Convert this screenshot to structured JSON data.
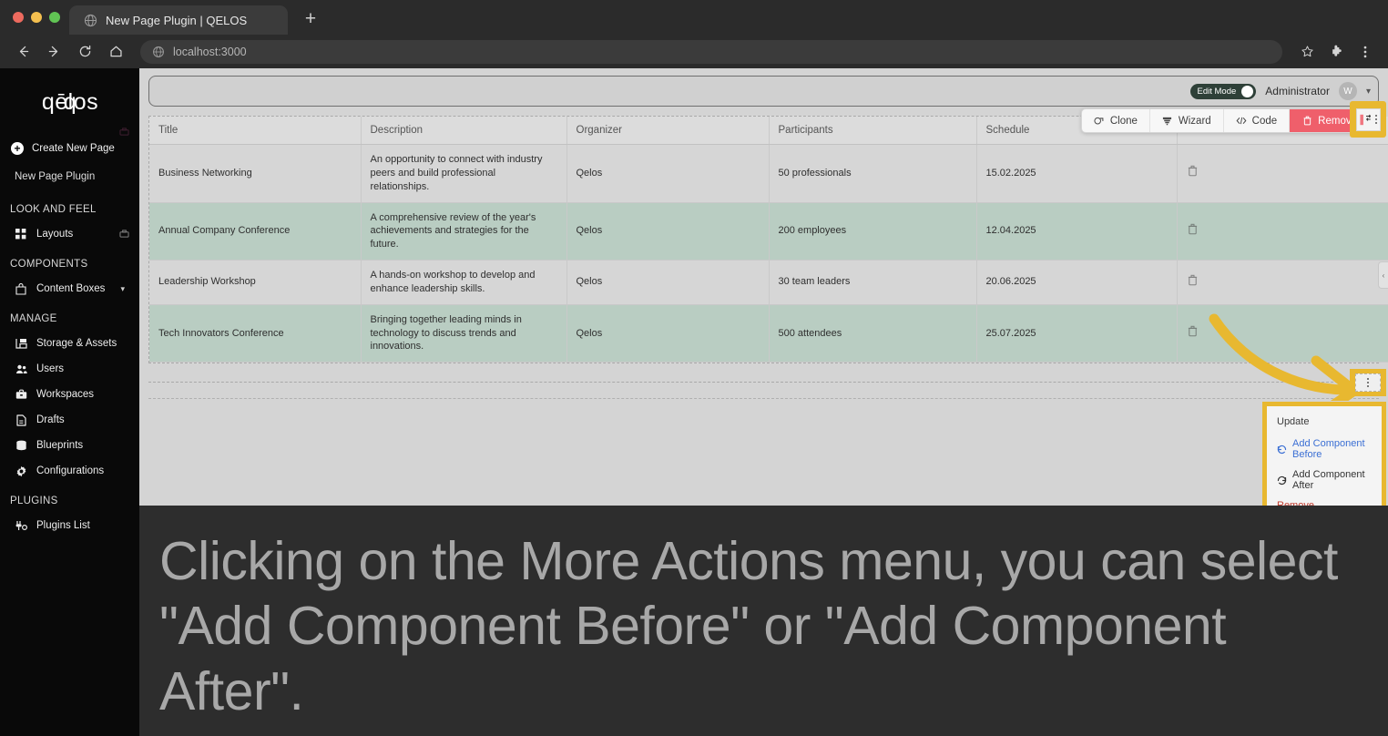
{
  "browser": {
    "tab_title": "New Page Plugin | QELOS",
    "tab_favicon_icon": "globe-icon",
    "new_tab_label": "+",
    "back_icon": "back-arrow-icon",
    "forward_icon": "forward-arrow-icon",
    "reload_icon": "reload-icon",
    "home_icon": "home-icon",
    "url": "localhost:3000",
    "url_favicon_icon": "globe-icon",
    "bookmark_icon": "star-icon",
    "extensions_icon": "puzzle-piece-icon",
    "menu_icon": "vertical-dots-icon"
  },
  "sidebar": {
    "logo": "qēlos",
    "create_new_page": "Create New Page",
    "new_page_plugin": "New Page Plugin",
    "sections": [
      {
        "title": "LOOK AND FEEL",
        "items": [
          {
            "label": "Layouts",
            "icon": "grid-icon",
            "has_tag": true
          }
        ]
      },
      {
        "title": "COMPONENTS",
        "items": [
          {
            "label": "Content Boxes",
            "icon": "box-icon",
            "has_chevron": true
          }
        ]
      },
      {
        "title": "MANAGE",
        "items": [
          {
            "label": "Storage & Assets",
            "icon": "storage-icon"
          },
          {
            "label": "Users",
            "icon": "users-icon"
          },
          {
            "label": "Workspaces",
            "icon": "briefcase-icon"
          },
          {
            "label": "Drafts",
            "icon": "document-icon"
          },
          {
            "label": "Blueprints",
            "icon": "database-icon"
          },
          {
            "label": "Configurations",
            "icon": "gear-icon"
          }
        ]
      },
      {
        "title": "PLUGINS",
        "items": [
          {
            "label": "Plugins List",
            "icon": "plug-icon"
          }
        ]
      }
    ]
  },
  "topbar": {
    "edit_mode_label": "Edit Mode",
    "edit_mode_on": true,
    "user_name": "Administrator",
    "avatar_initial": "W",
    "caret_icon": "chevron-down-icon"
  },
  "toolbar": {
    "buttons": [
      {
        "label": "Clone",
        "icon": "clone-icon"
      },
      {
        "label": "Wizard",
        "icon": "wizard-icon"
      },
      {
        "label": "Code",
        "icon": "code-icon"
      },
      {
        "label": "Remove",
        "icon": "trash-icon",
        "danger": true
      }
    ],
    "more_actions_icon": "more-actions-icon"
  },
  "table": {
    "columns": [
      "Title",
      "Description",
      "Organizer",
      "Participants",
      "Schedule",
      ""
    ],
    "row_action_icon": "trash-icon",
    "rows": [
      {
        "title": "Business Networking",
        "description": "An opportunity to connect with industry peers and build professional relationships.",
        "organizer": "Qelos",
        "participants": "50 professionals",
        "schedule": "15.02.2025"
      },
      {
        "title": "Annual Company Conference",
        "description": "A comprehensive review of the year's achievements and strategies for the future.",
        "organizer": "Qelos",
        "participants": "200 employees",
        "schedule": "12.04.2025"
      },
      {
        "title": "Leadership Workshop",
        "description": "A hands-on workshop to develop and enhance leadership skills.",
        "organizer": "Qelos",
        "participants": "30 team leaders",
        "schedule": "20.06.2025"
      },
      {
        "title": "Tech Innovators Conference",
        "description": "Bringing together leading minds in technology to discuss trends and innovations.",
        "organizer": "Qelos",
        "participants": "500 attendees",
        "schedule": "25.07.2025"
      }
    ]
  },
  "dropdown": {
    "header": "Update",
    "items": [
      {
        "label": "Add Component Before",
        "icon": "rotate-ccw-icon",
        "style": "blue"
      },
      {
        "label": "Add Component After",
        "icon": "rotate-cw-icon",
        "style": "normal"
      },
      {
        "label": "Remove",
        "icon": "none",
        "style": "red"
      }
    ]
  },
  "caption": {
    "text": "Clicking on the More Actions menu, you can select \"Add Component Before\" or \"Add Component After\"."
  },
  "colors": {
    "highlight": "#e8b830",
    "danger": "#ef5f6b",
    "link_blue": "#3b6fd4",
    "row_alt": "#b9cdc2",
    "sidebar_bg": "#090909"
  }
}
